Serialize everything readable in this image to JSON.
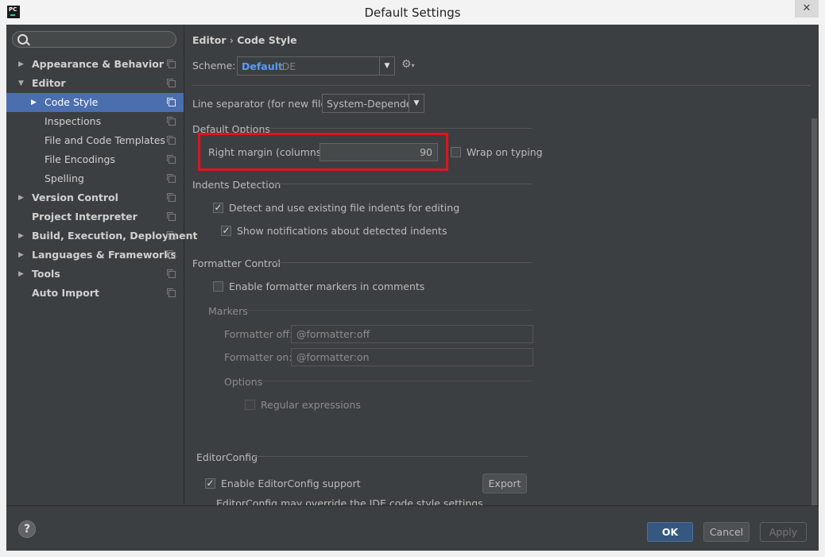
{
  "window": {
    "title": "Default Settings",
    "app_icon": "PC",
    "close": "✕"
  },
  "sidebar": {
    "search_placeholder": "",
    "items": [
      {
        "label": "Appearance & Behavior"
      },
      {
        "label": "Editor"
      },
      {
        "label": "Code Style"
      },
      {
        "label": "Inspections"
      },
      {
        "label": "File and Code Templates"
      },
      {
        "label": "File Encodings"
      },
      {
        "label": "Spelling"
      },
      {
        "label": "Version Control"
      },
      {
        "label": "Project Interpreter"
      },
      {
        "label": "Build, Execution, Deployment"
      },
      {
        "label": "Languages & Frameworks"
      },
      {
        "label": "Tools"
      },
      {
        "label": "Auto Import"
      }
    ]
  },
  "breadcrumb": {
    "parent": "Editor",
    "sep": "›",
    "current": "Code Style"
  },
  "scheme": {
    "label": "Scheme:",
    "name": "Default",
    "type": "IDE"
  },
  "line_separator": {
    "label": "Line separator (for new files):",
    "value": "System-Dependent"
  },
  "default_options": {
    "title": "Default Options",
    "right_margin_label": "Right margin (columns):",
    "right_margin_value": "90",
    "wrap_label": "Wrap on typing",
    "wrap_checked": false
  },
  "indents": {
    "title": "Indents Detection",
    "detect_label": "Detect and use existing file indents for editing",
    "detect_checked": true,
    "notify_label": "Show notifications about detected indents",
    "notify_checked": true
  },
  "formatter": {
    "title": "Formatter Control",
    "enable_label": "Enable formatter markers in comments",
    "enable_checked": false,
    "markers_title": "Markers",
    "off_label": "Formatter off:",
    "off_value": "@formatter:off",
    "on_label": "Formatter on:",
    "on_value": "@formatter:on",
    "options_title": "Options",
    "regex_label": "Regular expressions",
    "regex_checked": false
  },
  "editorconfig": {
    "title": "EditorConfig",
    "enable_label": "Enable EditorConfig support",
    "enable_checked": true,
    "export_label": "Export",
    "note": "EditorConfig may override the IDE code style settings"
  },
  "footer": {
    "help": "?",
    "ok": "OK",
    "cancel": "Cancel",
    "apply": "Apply"
  },
  "colors": {
    "accent": "#4b6eaf",
    "highlight": "#e0141e",
    "scheme_name": "#589df6",
    "background": "#3c3f41"
  }
}
